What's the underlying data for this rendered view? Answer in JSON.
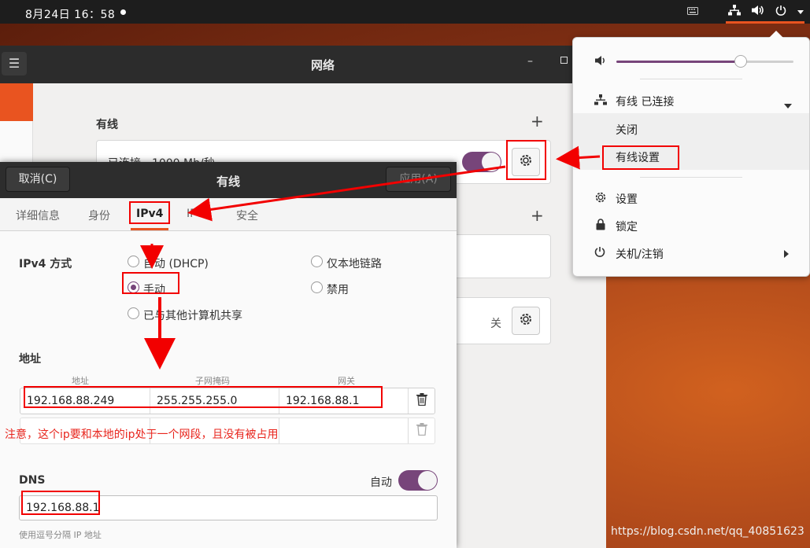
{
  "topbar": {
    "date": "8月24日  16：58"
  },
  "settings_window": {
    "title": "网络",
    "wired_section": "有线",
    "status_text": "已连接 - 1000 Mb/秒",
    "off_text": "关"
  },
  "dialog": {
    "title": "有线",
    "cancel": "取消(C)",
    "apply": "应用(A)",
    "tabs": [
      "详细信息",
      "身份",
      "IPv4",
      "IPv6",
      "安全"
    ],
    "ipv4_method_label": "IPv4 方式",
    "method_options": {
      "auto": "自动 (DHCP)",
      "link_local": "仅本地链路",
      "manual": "手动",
      "disable": "禁用",
      "shared": "已与其他计算机共享"
    },
    "selected_method": "手动",
    "address_section": "地址",
    "address_headers": [
      "地址",
      "子网掩码",
      "网关"
    ],
    "address_row": {
      "address": "192.168.88.249",
      "netmask": "255.255.255.0",
      "gateway": "192.168.88.1"
    },
    "dns_label": "DNS",
    "dns_auto_label": "自动",
    "dns_value": "192.168.88.1",
    "dns_hint": "使用逗号分隔 IP 地址"
  },
  "annotation_note": "注意，这个ip要和本地的ip处于一个网段，且没有被占用",
  "system_menu": {
    "volume_fraction": 0.7,
    "wired_status": "有线 已连接",
    "turn_off": "关闭",
    "wired_settings": "有线设置",
    "settings": "设置",
    "lock": "锁定",
    "power": "关机/注销"
  },
  "watermark": "https://blog.csdn.net/qq_40851623",
  "colors": {
    "accent": "#e95420",
    "toggle": "#77457a",
    "annotation_red": "#f20000"
  }
}
